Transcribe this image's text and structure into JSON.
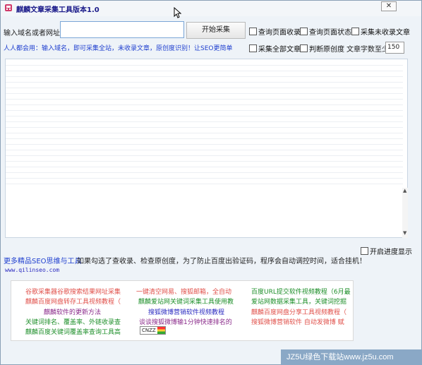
{
  "window": {
    "title": "麒麟文章采集工具版本1.0",
    "close_label": "✕"
  },
  "toolbar": {
    "url_label": "输入域名或者网址",
    "url_value": "",
    "start_button": "开始采集",
    "cb_query_index": "查询页面收录",
    "cb_query_status": "查询页面状态",
    "cb_collect_unindexed": "采集未收录文章",
    "tagline": "人人都会用：输入域名，即可采集全站，未收录文章，原创度识别！让SEO更简单",
    "cb_collect_all": "采集全部文章",
    "cb_judge_original": "判断原创度",
    "min_words_label": "文章字数至少",
    "min_words_value": "150"
  },
  "bottom": {
    "more_link": "更多精品SEO思维与工具",
    "notice": "如果勾选了查收录、检查原创度，为了防止百度出验证码，程序会自动调控时间，适合挂机！",
    "cb_progress": "开启进度显示",
    "site": "www.qilinseo.com"
  },
  "ads": {
    "col1": [
      "谷歌采集器谷歌搜索结果网址采集",
      "麒麟百度网盘转存工具视频教程（",
      "麒麟软件的更新方法",
      "关键词排名、覆盖率、外链收录查",
      "麒麟百度关键词覆盖率查询工具高"
    ],
    "col2": [
      "一键清空网易、搜狐邮箱，全自动",
      "麒麟爱站网关键词采集工具使用教",
      "搜狐微博营销软件视频教程",
      "谈谈搜狐微博输1分钟快速排名的"
    ],
    "col3": [
      "百度URL提交软件视频教程（6月最",
      "爱站网数据采集工具，关键词挖掘",
      "麒麟百度网盘分享工具视频教程（",
      "搜狐微博营销软件 自动发微博 赋"
    ],
    "cnzz": "CNZZ",
    "colors": {
      "red": "#e0504a",
      "green": "#1e8f2a",
      "purple": "#8a2a8a",
      "blue": "#2a2ac0"
    }
  },
  "watermark": "JZ5U绿色下载站www.jz5u.com"
}
